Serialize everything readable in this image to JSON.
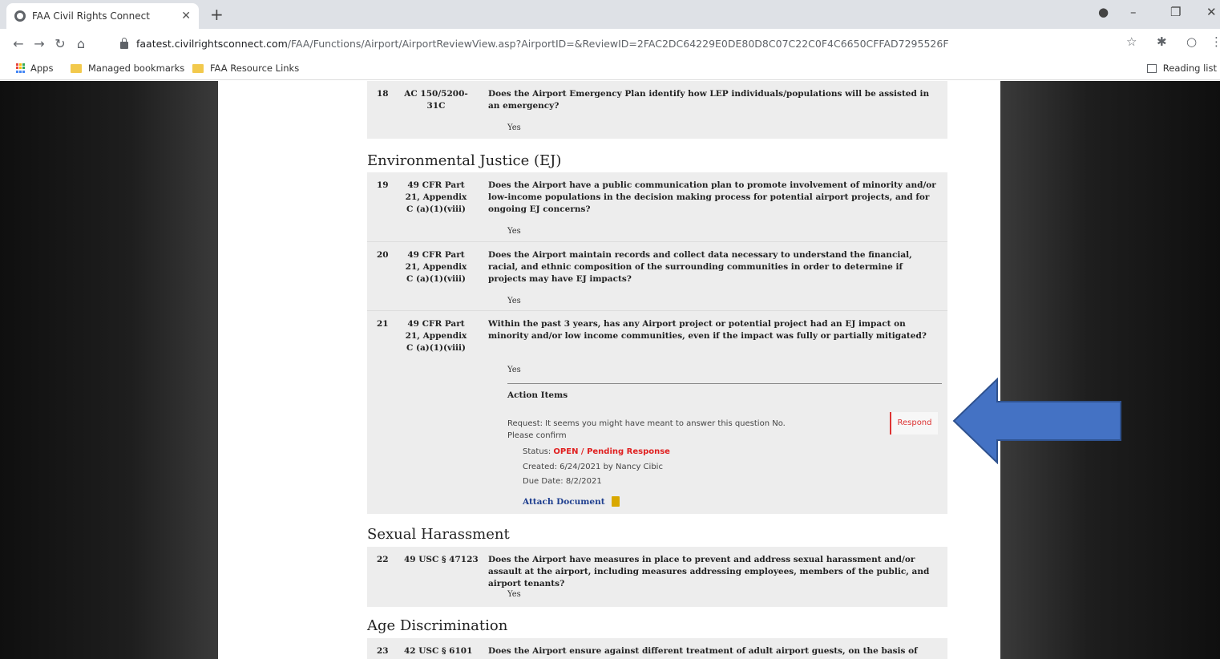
{
  "browser": {
    "tab_title": "FAA Civil Rights Connect",
    "url_host": "faatest.civilrightsconnect.com",
    "url_path": "/FAA/Functions/Airport/AirportReviewView.asp?AirportID=&ReviewID=2FAC2DC64229E0DE80D8C07C22C0F4C6650CFFAD7295526F",
    "bookmarks": [
      "Apps",
      "Managed bookmarks",
      "FAA Resource Links"
    ],
    "reading_list": "Reading list"
  },
  "questions": {
    "q18": {
      "num": "18",
      "ref": "AC 150/5200-31C",
      "text": "Does the Airport Emergency Plan identify how LEP individuals/populations will be assisted in an emergency?",
      "answer": "Yes"
    },
    "q19": {
      "num": "19",
      "ref": "49 CFR Part 21, Appendix C (a)(1)(viii)",
      "text": "Does the Airport have a public communication plan to promote involvement of minority and/or low-income populations in the decision making process for potential airport projects, and for ongoing EJ concerns?",
      "answer": "Yes"
    },
    "q20": {
      "num": "20",
      "ref": "49 CFR Part 21, Appendix C (a)(1)(viii)",
      "text": "Does the Airport maintain records and collect data necessary to understand the financial, racial, and ethnic composition of the surrounding communities in order to determine if projects may have EJ impacts?",
      "answer": "Yes"
    },
    "q21": {
      "num": "21",
      "ref": "49 CFR Part 21, Appendix C (a)(1)(viii)",
      "text": "Within the past 3 years, has any Airport project or potential project had an EJ impact on minority and/or low income communities, even if the impact was fully or partially mitigated?",
      "answer": "Yes"
    },
    "q22": {
      "num": "22",
      "ref": "49 USC § 47123",
      "text": "Does the Airport have measures in place to prevent and address sexual harassment and/or assault at the airport, including measures addressing employees, members of the public, and airport tenants?",
      "answer": "Yes"
    },
    "q23": {
      "num": "23",
      "ref": "42 USC § 6101",
      "text": "Does the Airport ensure against different treatment of adult airport guests, on the basis of age?"
    }
  },
  "sections": {
    "ej": "Environmental Justice (EJ)",
    "sh": "Sexual Harassment",
    "age": "Age Discrimination"
  },
  "action_items": {
    "heading": "Action Items",
    "request": "Request: It seems you might have meant to answer this question No. Please confirm",
    "respond": "Respond",
    "status_label": "Status:",
    "status_value": "OPEN / Pending Response",
    "created": "Created: 6/24/2021 by Nancy Cibic",
    "due": "Due Date: 8/2/2021",
    "attach": "Attach Document"
  },
  "colors": {
    "arrow": "#4472c4",
    "status": "#e02020",
    "link": "#1f3f8f"
  }
}
